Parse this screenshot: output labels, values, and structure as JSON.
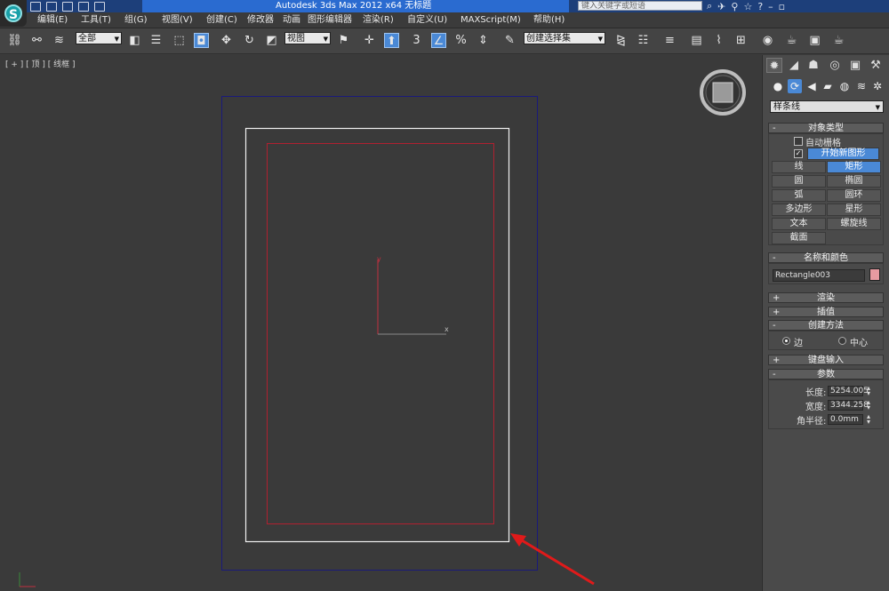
{
  "titlebar": {
    "title": "Autodesk 3ds Max  2012 x64     无标题",
    "search_placeholder": "键入关键字或短语"
  },
  "menubar": {
    "items": [
      "编辑(E)",
      "工具(T)",
      "组(G)",
      "视图(V)",
      "创建(C)",
      "修改器",
      "动画",
      "图形编辑器",
      "渲染(R)",
      "自定义(U)",
      "MAXScript(M)",
      "帮助(H)"
    ]
  },
  "toolbar": {
    "selection_filter": "全部",
    "reference_coord": "视图",
    "named_selection": "创建选择集",
    "snap_angle_label": "3"
  },
  "viewport": {
    "label": "[ + ] [ 顶 ] [ 线框 ]",
    "axis_y": "y",
    "axis_x": "x"
  },
  "command_panel": {
    "category": "样条线",
    "object_type": {
      "header": "对象类型",
      "autogrid": "自动栅格",
      "start_new_shape": "开始新图形",
      "start_new_shape_checked": true,
      "buttons": [
        [
          "线",
          "矩形"
        ],
        [
          "圆",
          "椭圆"
        ],
        [
          "弧",
          "圆环"
        ],
        [
          "多边形",
          "星形"
        ],
        [
          "文本",
          "螺旋线"
        ],
        [
          "截面",
          ""
        ]
      ],
      "active": "矩形"
    },
    "name_color": {
      "header": "名称和颜色",
      "object_name": "Rectangle003",
      "swatch_color": "#e89aa0"
    },
    "render": {
      "header": "渲染"
    },
    "interpolation": {
      "header": "插值"
    },
    "creation_method": {
      "header": "创建方法",
      "options": [
        "边",
        "中心"
      ],
      "selected": "边"
    },
    "keyboard_entry": {
      "header": "键盘输入"
    },
    "parameters": {
      "header": "参数",
      "length_label": "长度:",
      "length_value": "5254.005",
      "width_label": "宽度:",
      "width_value": "3344.258",
      "corner_label": "角半径:",
      "corner_value": "0.0mm"
    }
  },
  "colors": {
    "accent": "#4a89d6",
    "frame_blue": "#1a1a7a",
    "shape_red": "#b02030",
    "shape_white": "#f0f0f0",
    "annotation_arrow": "#e01a1a"
  }
}
